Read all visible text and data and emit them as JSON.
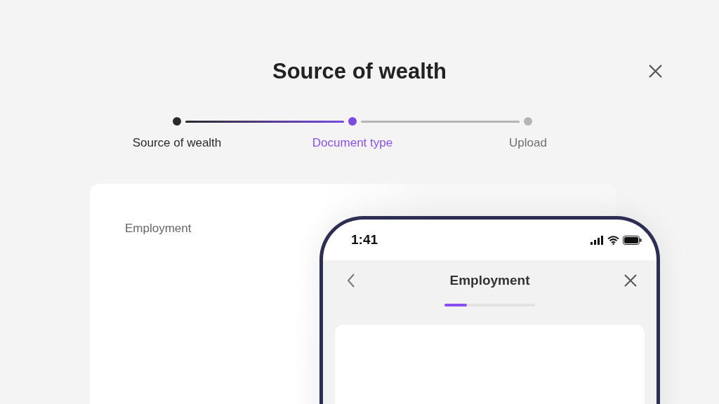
{
  "title": "Source of wealth",
  "steps": [
    {
      "label": "Source of wealth",
      "completed": true,
      "selected": false
    },
    {
      "label": "Document type",
      "completed": false,
      "selected": true
    },
    {
      "label": "Upload",
      "completed": false,
      "selected": false
    }
  ],
  "card": {
    "label": "Employment"
  },
  "phone": {
    "time": "1:41",
    "title": "Employment",
    "progress": {
      "level": 0.25
    }
  }
}
